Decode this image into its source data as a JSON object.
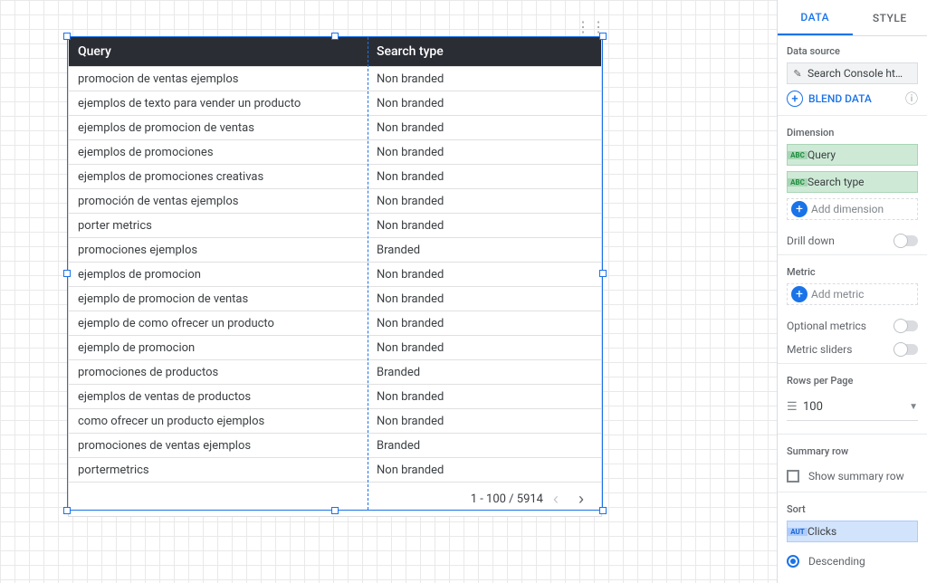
{
  "table": {
    "header": {
      "col1": "Query",
      "col2": "Search type"
    },
    "rows": [
      {
        "q": "promocion de ventas ejemplos",
        "t": "Non branded"
      },
      {
        "q": "ejemplos de texto para vender un producto",
        "t": "Non branded"
      },
      {
        "q": "ejemplos de promocion de ventas",
        "t": "Non branded"
      },
      {
        "q": "ejemplos de promociones",
        "t": "Non branded"
      },
      {
        "q": "ejemplos de promociones creativas",
        "t": "Non branded"
      },
      {
        "q": "promoción de ventas ejemplos",
        "t": "Non branded"
      },
      {
        "q": "porter metrics",
        "t": "Non branded"
      },
      {
        "q": "promociones ejemplos",
        "t": "Branded"
      },
      {
        "q": "ejemplos de promocion",
        "t": "Non branded"
      },
      {
        "q": "ejemplo de promocion de ventas",
        "t": "Non branded"
      },
      {
        "q": "ejemplo de como ofrecer un producto",
        "t": "Non branded"
      },
      {
        "q": "ejemplo de promocion",
        "t": "Non branded"
      },
      {
        "q": "promociones de productos",
        "t": "Branded"
      },
      {
        "q": "ejemplos de ventas de productos",
        "t": "Non branded"
      },
      {
        "q": "como ofrecer un producto ejemplos",
        "t": "Non branded"
      },
      {
        "q": "promociones de ventas ejemplos",
        "t": "Branded"
      },
      {
        "q": "portermetrics",
        "t": "Non branded"
      }
    ],
    "pager": "1 - 100 / 5914"
  },
  "panel": {
    "tabs": {
      "data": "DATA",
      "style": "STYLE"
    },
    "data_source": {
      "title": "Data source",
      "name": "Search Console ht…",
      "blend": "BLEND DATA"
    },
    "dimension": {
      "title": "Dimension",
      "items": [
        "Query",
        "Search type"
      ],
      "add": "Add dimension"
    },
    "drill_down": "Drill down",
    "metric": {
      "title": "Metric",
      "add": "Add metric"
    },
    "optional_metrics": "Optional metrics",
    "metric_sliders": "Metric sliders",
    "rows_per_page": {
      "title": "Rows per Page",
      "value": "100"
    },
    "summary": {
      "title": "Summary row",
      "checkbox": "Show summary row"
    },
    "sort": {
      "title": "Sort",
      "field": "Clicks",
      "order": "Descending"
    }
  }
}
